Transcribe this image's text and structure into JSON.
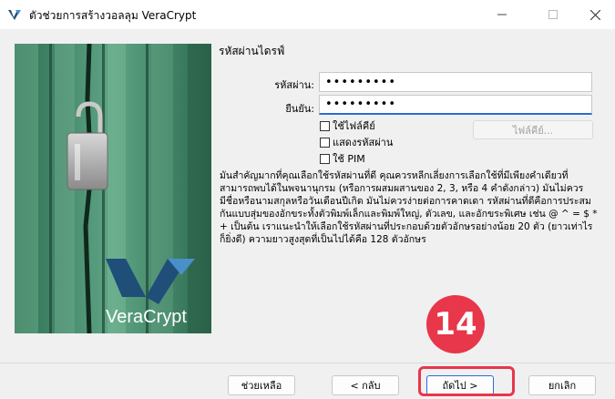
{
  "window": {
    "title": "ตัวช่วยการสร้างวอลลุม VeraCrypt"
  },
  "heading": "รหัสผ่านไดรฟ์",
  "password": {
    "label": "รหัสผ่าน:",
    "value": "•••••••••"
  },
  "confirm": {
    "label": "ยืนยัน:",
    "value": "•••••••••"
  },
  "options": {
    "use_keyfiles": "ใช้ไฟล์คีย์",
    "show_password": "แสดงรหัสผ่าน",
    "use_pim": "ใช้ PIM",
    "keyfiles_button": "ไฟล์คีย์..."
  },
  "info_text": "มันสำคัญมากที่คุณเลือกใช้รหัสผ่านที่ดี คุณควรหลีกเลี่ยงการเลือกใช้ที่มีเพียงคำเดียวที่สามารถพบได้ในพจนานุกรม (หรือการผสมผสานของ 2, 3, หรือ 4 คำดังกล่าว) มันไม่ควรมีชื่อหรือนามสกุลหรือวันเดือนปีเกิด มันไม่ควรง่ายต่อการคาดเดา รหัสผ่านที่ดีคือการประสมกันแบบสุ่มของอักขระทั้งตัวพิมพ์เล็กและพิมพ์ใหญ่, ตัวเลข, และอักขระพิเศษ เช่น @ ^ = $ * + เป็นต้น เราแนะนำให้เลือกใช้รหัสผ่านที่ประกอบด้วยตัวอักษรอย่างน้อย 20 ตัว (ยาวเท่าไร ก็ยิ่งดี) ความยาวสูงสุดที่เป็นไปได้คือ 128 ตัวอักษร",
  "logo_text": "VeraCrypt",
  "buttons": {
    "help": "ช่วยเหลือ",
    "back": "< กลับ",
    "next": "ถัดไป >",
    "cancel": "ยกเลิก"
  },
  "annotation": {
    "step": "14",
    "color": "#e8364a"
  },
  "colors": {
    "focus_border": "#2a6bd6",
    "door_green": "#3f8a68"
  }
}
